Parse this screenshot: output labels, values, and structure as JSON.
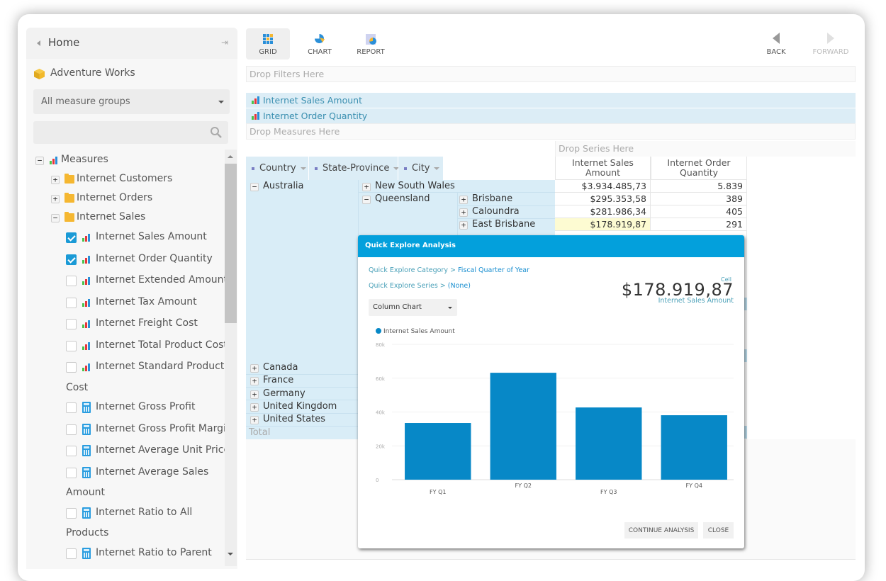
{
  "sidebar": {
    "home_label": "Home",
    "cube_name": "Adventure Works",
    "measure_group_select": "All measure groups",
    "search_placeholder": "",
    "tree": {
      "root_label": "Measures",
      "folders": [
        {
          "label": "Internet Customers",
          "expanded": false
        },
        {
          "label": "Internet Orders",
          "expanded": false
        },
        {
          "label": "Internet Sales",
          "expanded": true
        }
      ],
      "items": [
        {
          "label": "Internet Sales Amount",
          "checked": true,
          "icon": "bar-chart-icon"
        },
        {
          "label": "Internet Order Quantity",
          "checked": true,
          "icon": "bar-chart-icon"
        },
        {
          "label": "Internet Extended Amount",
          "checked": false,
          "icon": "bar-chart-icon"
        },
        {
          "label": "Internet Tax Amount",
          "checked": false,
          "icon": "bar-chart-icon"
        },
        {
          "label": "Internet Freight Cost",
          "checked": false,
          "icon": "bar-chart-icon"
        },
        {
          "label": "Internet Total Product Cost",
          "checked": false,
          "icon": "bar-chart-icon"
        },
        {
          "label": "Internet Standard Product",
          "label_cont": "Cost",
          "checked": false,
          "icon": "bar-chart-icon"
        },
        {
          "label": "Internet Gross Profit",
          "checked": false,
          "icon": "calculator-icon"
        },
        {
          "label": "Internet Gross Profit Margin",
          "checked": false,
          "icon": "calculator-icon"
        },
        {
          "label": "Internet Average Unit Price",
          "checked": false,
          "icon": "calculator-icon"
        },
        {
          "label": "Internet Average Sales",
          "label_cont": "Amount",
          "checked": false,
          "icon": "calculator-icon"
        },
        {
          "label": "Internet Ratio to All",
          "label_cont": "Products",
          "checked": false,
          "icon": "calculator-icon"
        },
        {
          "label": "Internet Ratio to Parent",
          "checked": false,
          "icon": "calculator-icon"
        }
      ]
    }
  },
  "toolbar": {
    "grid_label": "GRID",
    "chart_label": "CHART",
    "report_label": "REPORT",
    "back_label": "BACK",
    "forward_label": "FORWARD"
  },
  "zones": {
    "drop_filters": "Drop Filters Here",
    "measures": [
      "Internet Sales Amount",
      "Internet Order Quantity"
    ],
    "drop_measures": "Drop Measures Here",
    "drop_series": "Drop Series Here"
  },
  "grid": {
    "row_dimensions": [
      "Country",
      "State-Province",
      "City"
    ],
    "columns": [
      "Internet Sales Amount",
      "Internet Order Quantity"
    ],
    "rows": [
      {
        "country": "Australia",
        "state": "New South Wales",
        "city": "",
        "sales": "$3.934.485,73",
        "qty": "5.839"
      },
      {
        "country": "",
        "state": "Queensland",
        "city": "Brisbane",
        "sales": "$295.353,58",
        "qty": "389"
      },
      {
        "country": "",
        "state": "",
        "city": "Caloundra",
        "sales": "$281.986,34",
        "qty": "405"
      },
      {
        "country": "",
        "state": "",
        "city": "East Brisbane",
        "sales": "$178.919,87",
        "qty": "291"
      }
    ],
    "other_countries": [
      "Canada",
      "France",
      "Germany",
      "United Kingdom",
      "United States"
    ],
    "total_label": "Total"
  },
  "dialog": {
    "title": "Quick Explore Analysis",
    "category_prefix": "Quick Explore Category > ",
    "category_value": "Fiscal Quarter of Year",
    "series_prefix": "Quick Explore Series > ",
    "series_value": "(None)",
    "cell_caption": "Cell",
    "cell_value": "$178.919,87",
    "cell_measure": "Internet Sales Amount",
    "chart_type": "Column Chart",
    "continue_label": "CONTINUE ANALYSIS",
    "close_label": "CLOSE",
    "accent_color": "#03a0dc",
    "bar_color": "#0788c7"
  },
  "chart_data": {
    "type": "bar",
    "title": "",
    "legend": [
      "Internet Sales Amount"
    ],
    "legend_position": "top-left",
    "categories": [
      "FY Q1",
      "FY Q2",
      "FY Q3",
      "FY Q4"
    ],
    "values": [
      33500,
      63200,
      42700,
      38100
    ],
    "yticks": [
      "0",
      "20k",
      "40k",
      "60k",
      "80k"
    ],
    "ylim": [
      0,
      80000
    ],
    "xlabel": "",
    "ylabel": "",
    "grid": true
  }
}
